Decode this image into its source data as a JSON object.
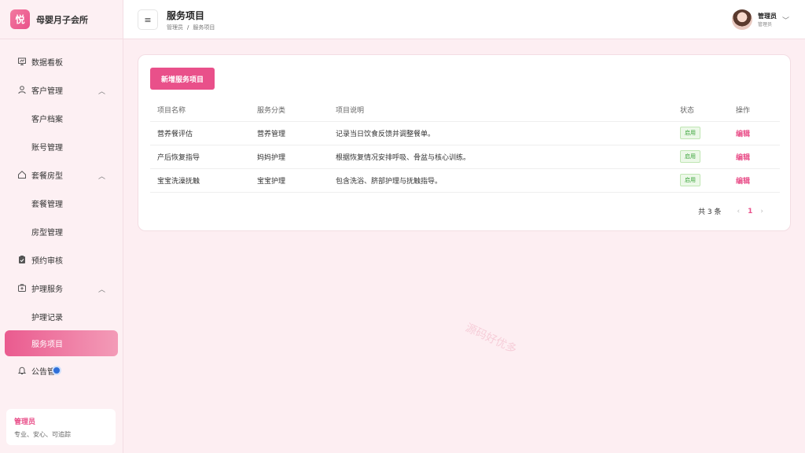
{
  "brand": {
    "logo_char": "悦",
    "name": "母婴月子会所"
  },
  "sidebar": {
    "items": [
      {
        "label": "数据看板",
        "icon": "dashboard-icon"
      },
      {
        "label": "客户管理",
        "icon": "user-icon"
      },
      {
        "label": "客户档案"
      },
      {
        "label": "账号管理"
      },
      {
        "label": "套餐房型",
        "icon": "home-icon"
      },
      {
        "label": "套餐管理"
      },
      {
        "label": "房型管理"
      },
      {
        "label": "预约审核",
        "icon": "clipboard-icon"
      },
      {
        "label": "护理服务",
        "icon": "medical-box-icon"
      },
      {
        "label": "护理记录"
      },
      {
        "label": "服务项目"
      },
      {
        "label": "公告管",
        "icon": "bell-icon"
      }
    ],
    "admin_card": {
      "name": "管理员",
      "desc": "专业、安心、可追踪"
    }
  },
  "header": {
    "title": "服务项目",
    "breadcrumb": [
      "管理员",
      "服务项目"
    ],
    "user": {
      "name": "管理员",
      "role": "管理员"
    }
  },
  "toolbar": {
    "add_label": "新增服务项目"
  },
  "table": {
    "headers": [
      "项目名称",
      "服务分类",
      "项目说明",
      "状态",
      "操作"
    ],
    "rows": [
      {
        "name": "营养餐评估",
        "category": "营养管理",
        "desc": "记录当日饮食反馈并调整餐单。",
        "status": "启用",
        "action": "编辑"
      },
      {
        "name": "产后恢复指导",
        "category": "妈妈护理",
        "desc": "根据恢复情况安排呼吸、骨盆与核心训练。",
        "status": "启用",
        "action": "编辑"
      },
      {
        "name": "宝宝洗澡抚触",
        "category": "宝宝护理",
        "desc": "包含洗浴、脐部护理与抚触指导。",
        "status": "启用",
        "action": "编辑"
      }
    ]
  },
  "pagination": {
    "total": "共 3 条",
    "current": "1"
  },
  "watermark": "源码好优多",
  "colors": {
    "accent": "#e9508a",
    "background": "#fdeef2",
    "status_green": "#3aa33a"
  }
}
